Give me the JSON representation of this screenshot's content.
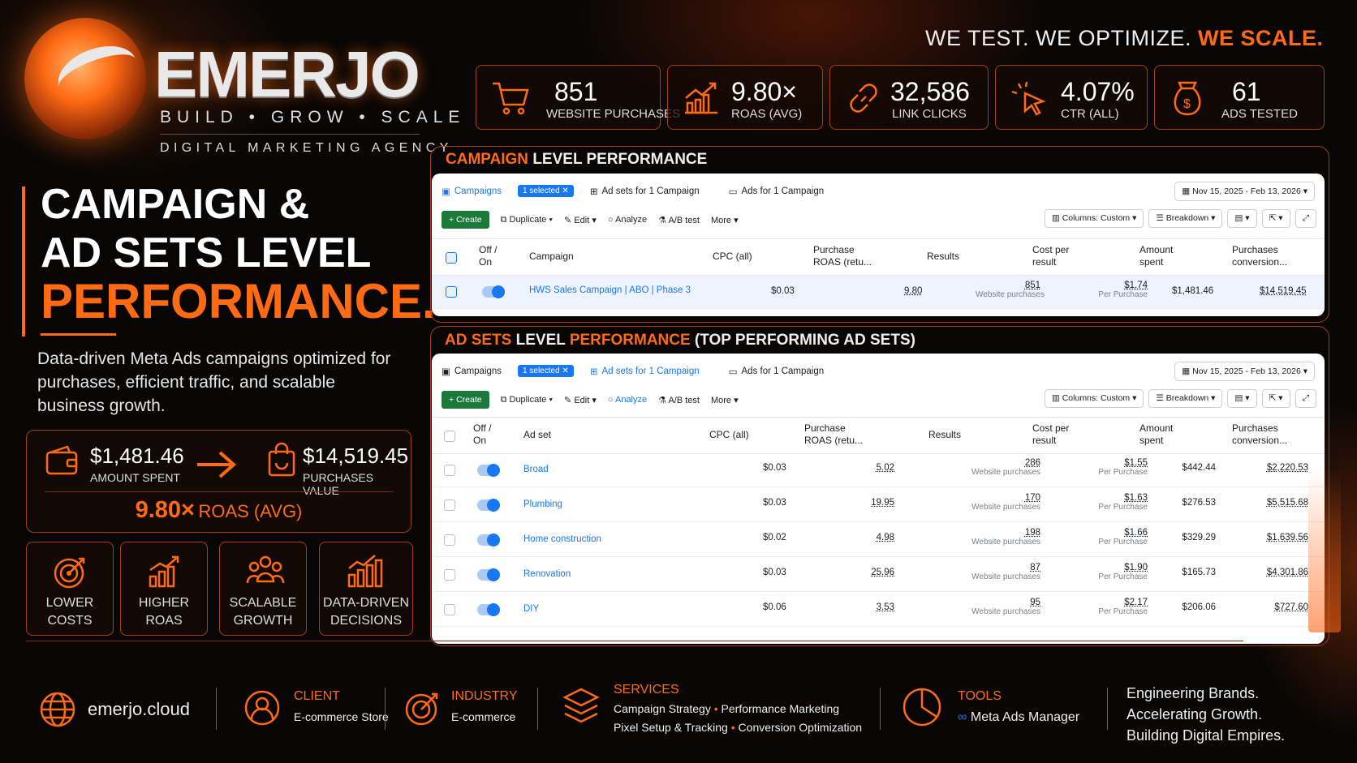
{
  "brand": {
    "name": "EMERJO",
    "tagline": "BUILD • GROW • SCALE",
    "subtitle": "DIGITAL MARKETING AGENCY"
  },
  "slogan": {
    "part1": "WE TEST. WE OPTIMIZE. ",
    "part2": "WE SCALE."
  },
  "headline": {
    "line1": "CAMPAIGN &",
    "line2": "AD SETS LEVEL",
    "line3": "PERFORMANCE."
  },
  "description": "Data-driven Meta Ads campaigns optimized for purchases, efficient traffic, and scalable business growth.",
  "kpis": [
    {
      "value": "851",
      "label": "WEBSITE PURCHASES",
      "icon": "cart-icon"
    },
    {
      "value": "9.80×",
      "label": "ROAS (AVG)",
      "icon": "growth-chart-icon"
    },
    {
      "value": "32,586",
      "label": "LINK CLICKS",
      "icon": "link-icon"
    },
    {
      "value": "4.07%",
      "label": "CTR (ALL)",
      "icon": "cursor-click-icon"
    },
    {
      "value": "61",
      "label": "ADS TESTED",
      "icon": "money-bag-icon"
    }
  ],
  "spend": {
    "amount": "$1,481.46",
    "amount_label": "AMOUNT SPENT",
    "value": "$14,519.45",
    "value_label": "PURCHASES VALUE",
    "roas_value": "9.80×",
    "roas_label": "ROAS (AVG)"
  },
  "benefits": [
    {
      "line1": "LOWER",
      "line2": "COSTS",
      "icon": "target-icon"
    },
    {
      "line1": "HIGHER",
      "line2": "ROAS",
      "icon": "bar-growth-icon"
    },
    {
      "line1": "SCALABLE",
      "line2": "GROWTH",
      "icon": "people-icon"
    },
    {
      "line1": "DATA-DRIVEN",
      "line2": "DECISIONS",
      "icon": "chart-up-icon"
    }
  ],
  "campaign_section": {
    "title_accent": "CAMPAIGN",
    "title_rest": " LEVEL PERFORMANCE"
  },
  "adset_section": {
    "title_accent": "AD SETS",
    "title_mid": " LEVEL ",
    "title_accent2": "PERFORMANCE",
    "title_rest": " (TOP PERFORMING AD SETS)"
  },
  "ui": {
    "tab_campaigns": "Campaigns",
    "selected": "1 selected",
    "tab_adsets": "Ad sets for 1 Campaign",
    "tab_ads": "Ads for 1 Campaign",
    "date_range": "Nov 15, 2025 - Feb 13, 2026",
    "create": "Create",
    "duplicate": "Duplicate",
    "edit": "Edit",
    "analyze": "Analyze",
    "ab_test": "A/B test",
    "more": "More",
    "columns": "Columns: Custom",
    "breakdown": "Breakdown"
  },
  "campaign_table": {
    "headers": {
      "offon": "Off /\nOn",
      "name": "Campaign",
      "cpc": "CPC (all)",
      "roas": "Purchase\nROAS (retu...",
      "results": "Results",
      "cpr": "Cost per\nresult",
      "spent": "Amount\nspent",
      "conv": "Purchases\nconversion..."
    },
    "row": {
      "name": "HWS Sales Campaign | ABO | Phase 3",
      "cpc": "$0.03",
      "roas": "9.80",
      "results": "851",
      "results_sub": "Website purchases",
      "cpr": "$1.74",
      "cpr_sub": "Per Purchase",
      "spent": "$1,481.46",
      "conv": "$14,519.45"
    }
  },
  "adset_table": {
    "headers": {
      "offon": "Off /\nOn",
      "name": "Ad set",
      "cpc": "CPC (all)",
      "roas": "Purchase\nROAS (retu...",
      "results": "Results",
      "cpr": "Cost per\nresult",
      "spent": "Amount\nspent",
      "conv": "Purchases\nconversion..."
    },
    "rows": [
      {
        "name": "Broad",
        "cpc": "$0.03",
        "roas": "5.02",
        "results": "286",
        "results_sub": "Website purchases",
        "cpr": "$1.55",
        "cpr_sub": "Per Purchase",
        "spent": "$442.44",
        "conv": "$2,220.53"
      },
      {
        "name": "Plumbing",
        "cpc": "$0.03",
        "roas": "19.95",
        "results": "170",
        "results_sub": "Website purchases",
        "cpr": "$1.63",
        "cpr_sub": "Per Purchase",
        "spent": "$276.53",
        "conv": "$5,515.68"
      },
      {
        "name": "Home construction",
        "cpc": "$0.02",
        "roas": "4.98",
        "results": "198",
        "results_sub": "Website purchases",
        "cpr": "$1.66",
        "cpr_sub": "Per Purchase",
        "spent": "$329.29",
        "conv": "$1,639.56"
      },
      {
        "name": "Renovation",
        "cpc": "$0.03",
        "roas": "25.96",
        "results": "87",
        "results_sub": "Website purchases",
        "cpr": "$1.90",
        "cpr_sub": "Per Purchase",
        "spent": "$165.73",
        "conv": "$4,301.86"
      },
      {
        "name": "DIY",
        "cpc": "$0.06",
        "roas": "3.53",
        "results": "95",
        "results_sub": "Website purchases",
        "cpr": "$2.17",
        "cpr_sub": "Per Purchase",
        "spent": "$206.06",
        "conv": "$727.60"
      }
    ]
  },
  "footer": {
    "website": "emerjo.cloud",
    "client_title": "CLIENT",
    "client": "E-commerce Store",
    "industry_title": "INDUSTRY",
    "industry": "E-commerce",
    "services_title": "SERVICES",
    "services": [
      "Campaign Strategy",
      "Performance Marketing",
      "Pixel Setup & Tracking",
      "Conversion Optimization"
    ],
    "tools_title": "TOOLS",
    "tool": "Meta Ads Manager",
    "motto": [
      "Engineering Brands.",
      "Accelerating Growth.",
      "Building Digital Empires."
    ]
  },
  "colors": {
    "accent": "#ff6a13",
    "meta_blue": "#1877f2",
    "create_green": "#1b7a3a"
  }
}
